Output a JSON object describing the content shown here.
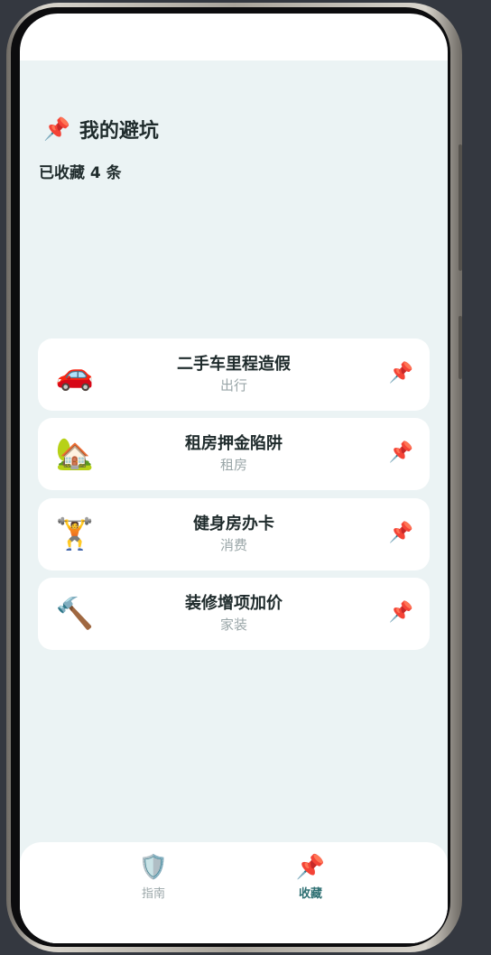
{
  "header": {
    "title": "我的避坑",
    "title_icon": "pushpin-icon",
    "count_text": "已收藏 4 条"
  },
  "favorites": [
    {
      "icon": "🚗",
      "icon_name": "car-icon",
      "title": "二手车里程造假",
      "category": "出行"
    },
    {
      "icon": "🏡",
      "icon_name": "house-icon",
      "title": "租房押金陷阱",
      "category": "租房"
    },
    {
      "icon": "🏋️",
      "icon_name": "weightlifter-icon",
      "title": "健身房办卡",
      "category": "消费"
    },
    {
      "icon": "🔨",
      "icon_name": "hammer-icon",
      "title": "装修增项加价",
      "category": "家装"
    }
  ],
  "tabbar": {
    "guide": {
      "label": "指南",
      "icon": "shield-icon"
    },
    "favorites": {
      "label": "收藏",
      "icon": "pushpin-icon"
    }
  },
  "colors": {
    "page_background": "#ebf3f4",
    "card_background": "#ffffff",
    "title_text": "#1f2b2c",
    "muted_text": "#9aa6a8",
    "active_tab": "#2d6f72",
    "pin_red": "#d7262b"
  }
}
